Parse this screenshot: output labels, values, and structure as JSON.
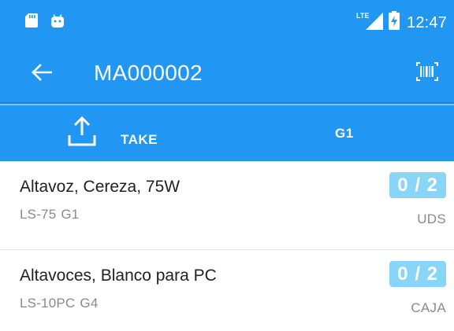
{
  "status_bar": {
    "network": "LTE",
    "time": "12:47"
  },
  "toolbar": {
    "title": "MA000002",
    "back_icon": "arrow-back-icon",
    "scan_icon": "barcode-scan-icon"
  },
  "action_bar": {
    "take_label": "TAKE",
    "take_icon": "upload-icon",
    "location": "G1"
  },
  "items": [
    {
      "name": "Altavoz, Cereza, 75W",
      "code": "LS-75",
      "location": "G1",
      "progress": "0 / 2",
      "unit": "UDS"
    },
    {
      "name": "Altavoces, Blanco para PC",
      "code": "LS-10PC",
      "location": "G4",
      "progress": "0 / 2",
      "unit": "CAJA"
    }
  ],
  "colors": {
    "primary": "#2196F3",
    "badge": "#88D5F7",
    "secondary_text": "#8A8A8A"
  }
}
